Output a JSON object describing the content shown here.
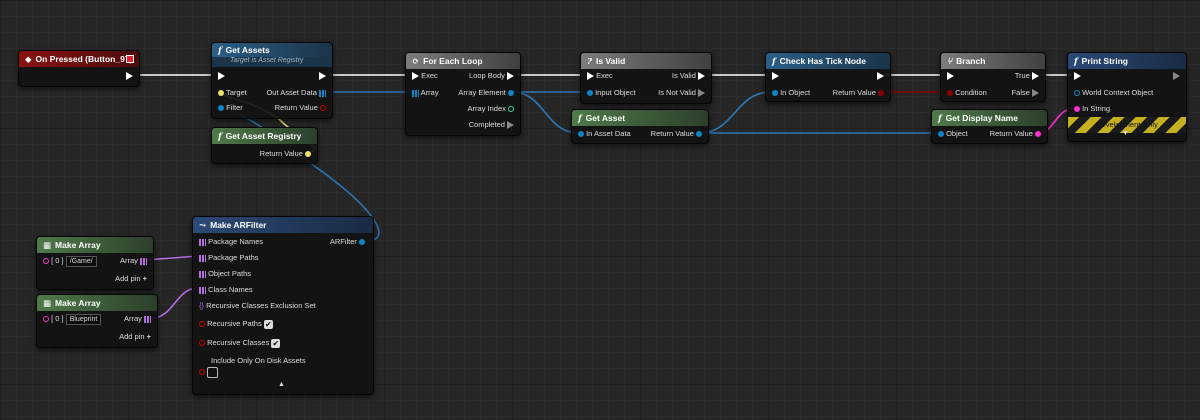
{
  "colors": {
    "exec": "#ffffff",
    "object": "#0e87c9",
    "bool": "#8c0000",
    "string": "#ff2fd1",
    "struct": "#b56de0",
    "registry": "#efe06a",
    "wire_object": "#2c78b8"
  },
  "nodes": {
    "on_pressed": {
      "title": "On Pressed (Button_97)"
    },
    "get_assets": {
      "title": "Get Assets",
      "subtitle": "Target is Asset Registry",
      "target": "Target",
      "filter": "Filter",
      "out_asset_data": "Out Asset Data",
      "return_value": "Return Value"
    },
    "get_asset_registry": {
      "title": "Get Asset Registry",
      "return_value": "Return Value"
    },
    "for_each": {
      "title": "For Each Loop",
      "exec": "Exec",
      "array": "Array",
      "loop_body": "Loop Body",
      "array_element": "Array Element",
      "array_index": "Array Index",
      "completed": "Completed"
    },
    "is_valid": {
      "title": "Is Valid",
      "exec": "Exec",
      "input_object": "Input Object",
      "is_valid": "Is Valid",
      "is_not_valid": "Is Not Valid"
    },
    "get_asset": {
      "title": "Get Asset",
      "in_asset_data": "In Asset Data",
      "return_value": "Return Value"
    },
    "check_tick": {
      "title": "Check Has Tick Node",
      "in_object": "In Object",
      "return_value": "Return Value"
    },
    "branch": {
      "title": "Branch",
      "condition": "Condition",
      "true": "True",
      "false": "False"
    },
    "get_display_name": {
      "title": "Get Display Name",
      "object": "Object",
      "return_value": "Return Value"
    },
    "print_string": {
      "title": "Print String",
      "world_context": "World Context Object",
      "in_string": "In String",
      "dev_only": "Development Only"
    },
    "make_array_1": {
      "title": "Make Array",
      "index": "[ 0 ]",
      "value": "/Game/",
      "array": "Array",
      "add_pin": "Add pin"
    },
    "make_array_2": {
      "title": "Make Array",
      "index": "[ 0 ]",
      "value": "Blueprint",
      "array": "Array",
      "add_pin": "Add pin"
    },
    "make_arfilter": {
      "title": "Make ARFilter",
      "arfilter": "ARFilter",
      "package_names": "Package Names",
      "package_paths": "Package Paths",
      "object_paths": "Object Paths",
      "class_names": "Class Names",
      "recursive_exclusion": "Recursive Classes Exclusion Set",
      "recursive_paths": "Recursive Paths",
      "recursive_classes": "Recursive Classes",
      "include_disk": "Include Only On Disk Assets",
      "recursive_paths_checked": true,
      "recursive_classes_checked": true,
      "include_disk_checked": false
    }
  }
}
